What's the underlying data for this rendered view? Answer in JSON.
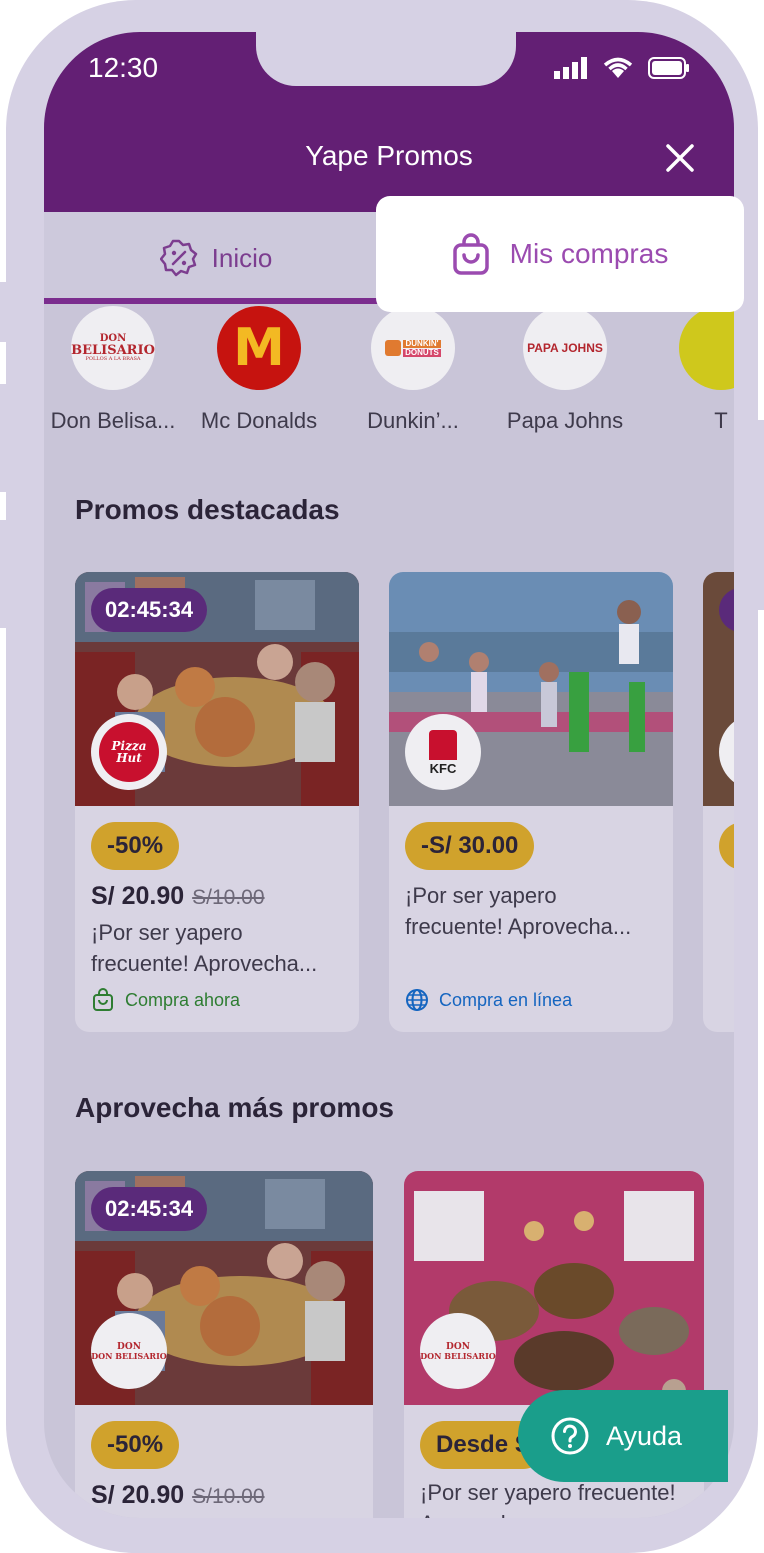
{
  "status_bar": {
    "time": "12:30",
    "icons": [
      "signal-icon",
      "wifi-icon",
      "battery-icon"
    ]
  },
  "header": {
    "title": "Yape Promos",
    "close_icon": "close-icon"
  },
  "tabs": {
    "inicio": {
      "label": "Inicio",
      "icon": "percent-badge-icon"
    },
    "mis_compras": {
      "label": "Mis compras",
      "icon": "shopping-bag-icon"
    }
  },
  "brands": [
    {
      "name": "Don Belisa...",
      "logo_text": "DON BELISARIO",
      "logo_sub": "POLLOS A LA BRASA"
    },
    {
      "name": "Mc Donalds",
      "logo_text": "M"
    },
    {
      "name": "Dunkin’...",
      "logo_text": "DUNKIN' DONUTS"
    },
    {
      "name": "Papa Johns",
      "logo_text": "PAPA JOHNS"
    },
    {
      "name": "T",
      "logo_text": ""
    }
  ],
  "sections": {
    "featured_title": "Promos destacadas",
    "more_title": "Aprovecha más promos"
  },
  "featured_cards": [
    {
      "timer": "02:45:34",
      "brand_logo": "Pizza Hut",
      "badge": "-50%",
      "price": "S/ 20.90",
      "old_price": "S/10.00",
      "description": "¡Por ser yapero frecuente! Aprovecha...",
      "action": "Compra ahora",
      "action_icon": "shopping-bag-icon"
    },
    {
      "brand_logo": "KFC",
      "badge": "-S/ 30.00",
      "description": "¡Por ser yapero frecuente! Aprovecha...",
      "action": "Compra en línea",
      "action_icon": "globe-icon"
    }
  ],
  "more_cards": [
    {
      "timer": "02:45:34",
      "brand_logo": "DON BELISARIO",
      "badge": "-50%",
      "price": "S/ 20.90",
      "old_price": "S/10.00"
    },
    {
      "brand_logo": "DON BELISARIO",
      "badge": "Desde S",
      "description": "¡Por ser yapero frecuente! Aprovecha..."
    }
  ],
  "help": {
    "label": "Ayuda",
    "icon": "question-circle-icon"
  },
  "colors": {
    "brand_purple": "#631f74",
    "accent_yellow": "#d0a22c",
    "help_teal": "#1a9e8b",
    "action_green": "#2e7d32",
    "action_blue": "#1565c0"
  }
}
